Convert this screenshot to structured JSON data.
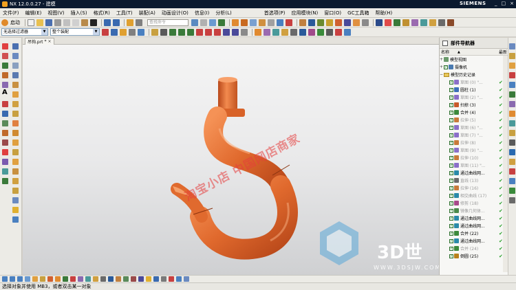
{
  "window": {
    "title": "NX 12.0.0.27 - 建模",
    "brand": "SIEMENS",
    "controls": [
      "_",
      "□",
      "×"
    ]
  },
  "menu": {
    "items": [
      "文件(F)",
      "编辑(E)",
      "视图(V)",
      "插入(S)",
      "格式(R)",
      "工具(T)",
      "装配(A)",
      "动画设计(O)",
      "信息(I)",
      "分析(L)",
      "首选项(P)",
      "应用模块(N)",
      "窗口(O)",
      "GC工具箱",
      "帮助(H)"
    ]
  },
  "toolbar": {
    "start_label": "启动",
    "search_placeholder": "查找命令",
    "selection_filter": "无选择过滤器",
    "assembly_scope": "整个装配"
  },
  "document": {
    "tab_label": "吊钩.prt",
    "tab_modified": "*"
  },
  "viewport": {
    "watermark": "淘宝小店  中国网店商家",
    "logo_text": "3D世",
    "logo_url": "WWW.3DSJW.COM"
  },
  "navigator": {
    "title": "部件导航器",
    "col_name": "名称",
    "col_latest": "最新",
    "top_nodes": [
      {
        "label": "模型视图",
        "expander": "+"
      },
      {
        "label": "摄像机",
        "expander": "+"
      },
      {
        "label": "模型历史记录",
        "expander": "−"
      }
    ],
    "features": [
      {
        "label": "草图 (0) \"...",
        "dim": true,
        "icon": "#8a6fc8"
      },
      {
        "label": "圆柱 (1)",
        "dim": false,
        "icon": "#3c6fb8"
      },
      {
        "label": "草图 (2) \"...",
        "dim": true,
        "icon": "#8a6fc8"
      },
      {
        "label": "扫掠 (3)",
        "dim": false,
        "icon": "#c85a2a"
      },
      {
        "label": "合并 (4)",
        "dim": false,
        "icon": "#3c8a3c"
      },
      {
        "label": "拉伸 (5)",
        "dim": true,
        "icon": "#c87a3a"
      },
      {
        "label": "草图 (6) \"...",
        "dim": true,
        "icon": "#8a6fc8"
      },
      {
        "label": "草图 (7) \"...",
        "dim": true,
        "icon": "#8a6fc8"
      },
      {
        "label": "拉伸 (8)",
        "dim": true,
        "icon": "#c87a3a"
      },
      {
        "label": "草图 (9) \"...",
        "dim": true,
        "icon": "#8a6fc8"
      },
      {
        "label": "拉伸 (10)",
        "dim": true,
        "icon": "#c87a3a"
      },
      {
        "label": "草图 (11) \"...",
        "dim": true,
        "icon": "#8a6fc8"
      },
      {
        "label": "通过曲线网...",
        "dim": false,
        "icon": "#2a8aa8"
      },
      {
        "label": "直线 (13)",
        "dim": true,
        "icon": "#6a6a6a"
      },
      {
        "label": "拉伸 (16)",
        "dim": true,
        "icon": "#c87a3a"
      },
      {
        "label": "相交曲线 (17)",
        "dim": true,
        "icon": "#2a8aa8"
      },
      {
        "label": "修剪 (18)",
        "dim": true,
        "icon": "#a84a8a"
      },
      {
        "label": "镜像几何体...",
        "dim": true,
        "icon": "#4a8a4a"
      },
      {
        "label": "通过曲线网...",
        "dim": false,
        "icon": "#2a8aa8"
      },
      {
        "label": "通过曲线网...",
        "dim": false,
        "icon": "#2a8aa8"
      },
      {
        "label": "合并 (22)",
        "dim": false,
        "icon": "#3c8a3c"
      },
      {
        "label": "通过曲线网...",
        "dim": false,
        "icon": "#2a8aa8"
      },
      {
        "label": "合并 (24)",
        "dim": true,
        "icon": "#3c8a3c"
      },
      {
        "label": "倒圆 (25)",
        "dim": false,
        "icon": "#b8801a"
      }
    ]
  },
  "status": {
    "text": "选择对象并使用 MB3，或者双击某一对象"
  },
  "colors": {
    "part": "#e0692d",
    "titlebar": "#0b1a2f",
    "watermark": "#e63c3c"
  }
}
